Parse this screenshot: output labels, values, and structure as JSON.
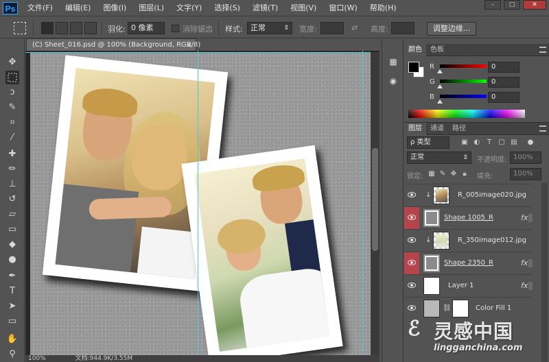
{
  "app": {
    "logo": "Ps",
    "menu": [
      "文件(F)",
      "编辑(E)",
      "图像(I)",
      "图层(L)",
      "文字(Y)",
      "选择(S)",
      "滤镜(T)",
      "视图(V)",
      "窗口(W)",
      "帮助(H)"
    ],
    "window_controls": [
      "–",
      "□",
      "✕"
    ]
  },
  "options": {
    "feather_label": "羽化:",
    "feather_value": "0 像素",
    "antialias_label": "消除锯齿",
    "style_label": "样式:",
    "style_value": "正常",
    "width_label": "宽度:",
    "height_label": "高度:",
    "refine_button": "调整边缘..."
  },
  "document": {
    "tab_title": "(C) Sheet_016.psd @ 100% (Background, RGB/8)",
    "tab_close": "×",
    "zoom": "100%",
    "status": "文档:944.9K/3.55M"
  },
  "color_panel": {
    "tabs": [
      "颜色",
      "色板"
    ],
    "channels": [
      {
        "label": "R",
        "value": "0",
        "color": "#e02020"
      },
      {
        "label": "G",
        "value": "0",
        "color": "#20c020"
      },
      {
        "label": "B",
        "value": "0",
        "color": "#2040e0"
      }
    ],
    "foreground": "#000000",
    "background": "#ffffff"
  },
  "layers_panel": {
    "tabs": [
      "图层",
      "通道",
      "路径"
    ],
    "filter_label": "ρ 类型",
    "blend_mode": "正常",
    "opacity_label": "不透明度:",
    "opacity_value": "100%",
    "lock_label": "锁定:",
    "fill_label": "填充:",
    "fill_value": "100%",
    "layers": [
      {
        "name": "R_005image020.jpg",
        "clipped": true,
        "thumb": "photo-couple",
        "fx": false,
        "eye_red": false
      },
      {
        "name": "Shape 1005_R",
        "clipped": false,
        "thumb": "shape",
        "fx": true,
        "eye_red": true
      },
      {
        "name": "R_350image012.jpg",
        "clipped": true,
        "thumb": "photo-couple2",
        "fx": false,
        "eye_red": false
      },
      {
        "name": "Shape 2350_R",
        "clipped": false,
        "thumb": "shape",
        "fx": true,
        "eye_red": true
      },
      {
        "name": "Layer 1",
        "clipped": false,
        "thumb": "white",
        "fx": true,
        "eye_red": false
      },
      {
        "name": "Color Fill 1",
        "clipped": false,
        "thumb": "grey",
        "fx": false,
        "eye_red": false
      }
    ]
  },
  "watermark": {
    "title": "灵感中国",
    "url": "lingganchina.com"
  },
  "colors": {
    "ui_bg": "#535353",
    "canvas_texture": "#9b9b9b",
    "guide": "#4fc9d4",
    "eye_highlight": "#b6444b"
  }
}
